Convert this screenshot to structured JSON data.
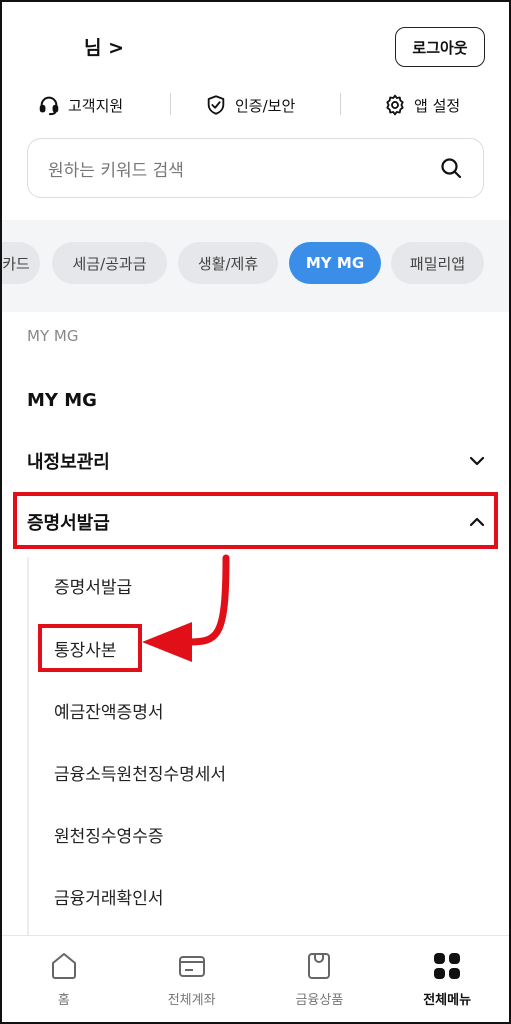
{
  "header": {
    "username_suffix": "님 >",
    "logout_label": "로그아웃",
    "quick_links": [
      "고객지원",
      "인증/보안",
      "앱 설정"
    ]
  },
  "search": {
    "placeholder": "원하는 키워드 검색"
  },
  "chips": [
    {
      "label": "카드",
      "active": false
    },
    {
      "label": "세금/공과금",
      "active": false
    },
    {
      "label": "생활/제휴",
      "active": false
    },
    {
      "label": "MY MG",
      "active": true
    },
    {
      "label": "패밀리앱",
      "active": false
    }
  ],
  "menu": {
    "section_label": "MY MG",
    "items": [
      {
        "label": "MY MG",
        "expandable": false
      },
      {
        "label": "내정보관리",
        "expandable": true,
        "expanded": false
      },
      {
        "label": "증명서발급",
        "expandable": true,
        "expanded": true
      }
    ],
    "sub_items": [
      "증명서발급",
      "통장사본",
      "예금잔액증명서",
      "금융소득원천징수명세서",
      "원천징수영수증",
      "금융거래확인서"
    ]
  },
  "annotation": {
    "color": "#e11018"
  },
  "bottom_nav": [
    {
      "label": "홈",
      "icon": "home-icon",
      "active": false
    },
    {
      "label": "전체계좌",
      "icon": "wallet-icon",
      "active": false
    },
    {
      "label": "금융상품",
      "icon": "shopping-bag-icon",
      "active": false
    },
    {
      "label": "전체메뉴",
      "icon": "grid-menu-icon",
      "active": true
    }
  ],
  "colors": {
    "accent": "#3b8ee8",
    "chip_bg": "#e6e7ea",
    "band_bg": "#f4f5f7"
  }
}
